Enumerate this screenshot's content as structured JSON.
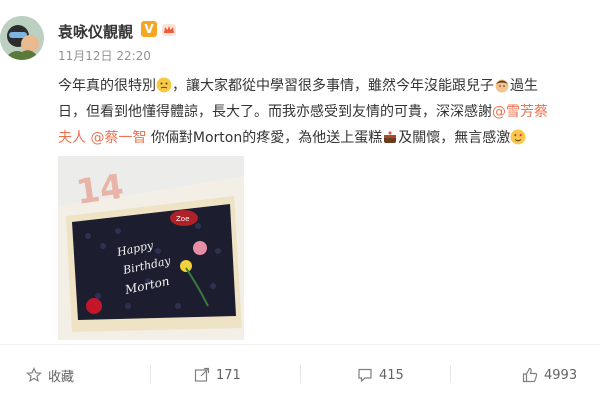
{
  "post": {
    "username": "袁咏仪靚靚",
    "timestamp": "11月12日 22:20",
    "text_line1": "今年真的很特別",
    "text_line1b": "，讓大家都從中學習很多事情，雖然今年沒能跟兒子",
    "text_line1c": "過生",
    "text_line2": "日，但看到他懂得體諒，長大了。而我亦感受到友情的可貴，深深感謝",
    "mention1": "@雪芳蔡",
    "mention1_cont": "夫人",
    "mention2": "@蔡一智",
    "text_line3": " 你倆對Morton的疼愛，為他送上蛋糕",
    "text_line3b": "及關懷，無言感激"
  },
  "actions": {
    "favorite": "收藏",
    "forward_count": "171",
    "comment_count": "415",
    "like_count": "4993"
  },
  "colors": {
    "accent": "#eb7350",
    "badge": "#f5a623"
  },
  "icons": [
    "v-badge-icon",
    "crown-icon",
    "star-icon",
    "share-icon",
    "comment-icon",
    "like-icon"
  ]
}
